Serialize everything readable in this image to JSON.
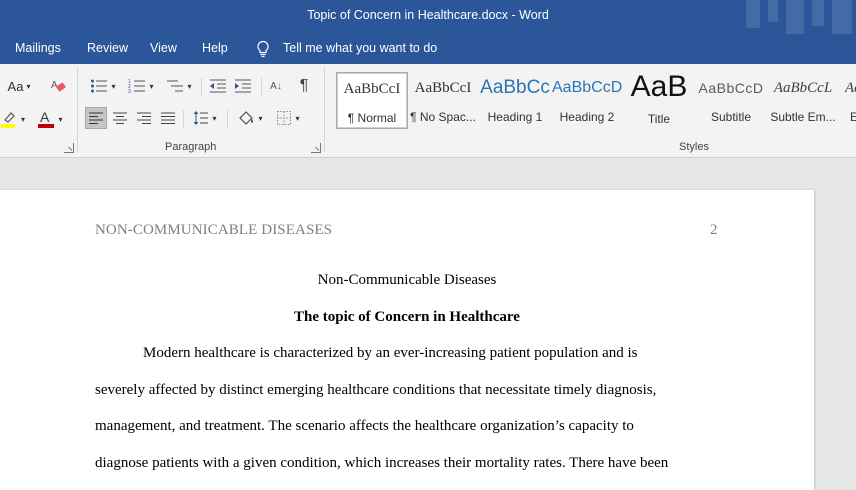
{
  "window": {
    "title": "Topic of Concern in Healthcare.docx  -  Word"
  },
  "menu": {
    "items": [
      "Mailings",
      "Review",
      "View",
      "Help"
    ],
    "tell_me": "Tell me what you want to do"
  },
  "ribbon": {
    "font_group": {
      "change_case_label": "Aa",
      "font_color": "#c00000",
      "highlight_color": "#ffff00"
    },
    "paragraph_group_label": "Paragraph",
    "styles_group_label": "Styles",
    "styles": [
      {
        "preview": "AaBbCcI",
        "name": "¶ Normal"
      },
      {
        "preview": "AaBbCcI",
        "name": "¶ No Spac..."
      },
      {
        "preview": "AaBbCc",
        "name": "Heading 1"
      },
      {
        "preview": "AaBbCcD",
        "name": "Heading 2"
      },
      {
        "preview": "AaB",
        "name": "Title"
      },
      {
        "preview": "AaBbCcD",
        "name": "Subtitle"
      },
      {
        "preview": "AaBbCcL",
        "name": "Subtle Em..."
      },
      {
        "preview": "Aa",
        "name": "E"
      }
    ]
  },
  "document": {
    "header_left": "NON-COMMUNICABLE DISEASES",
    "page_number": "2",
    "title": "Non-Communicable Diseases",
    "heading": "The topic of Concern in Healthcare",
    "lines": [
      "Modern healthcare is characterized by an ever-increasing patient population and is",
      "severely affected by distinct emerging healthcare conditions that necessitate timely diagnosis,",
      "management, and treatment. The scenario affects the healthcare organization’s capacity to",
      "diagnose patients with a given condition, which increases their mortality rates. There have been"
    ]
  },
  "colors": {
    "title_bar": "#2b579a",
    "ribbon_bg": "#f3f3f3",
    "heading_blue": "#2e74b5"
  }
}
